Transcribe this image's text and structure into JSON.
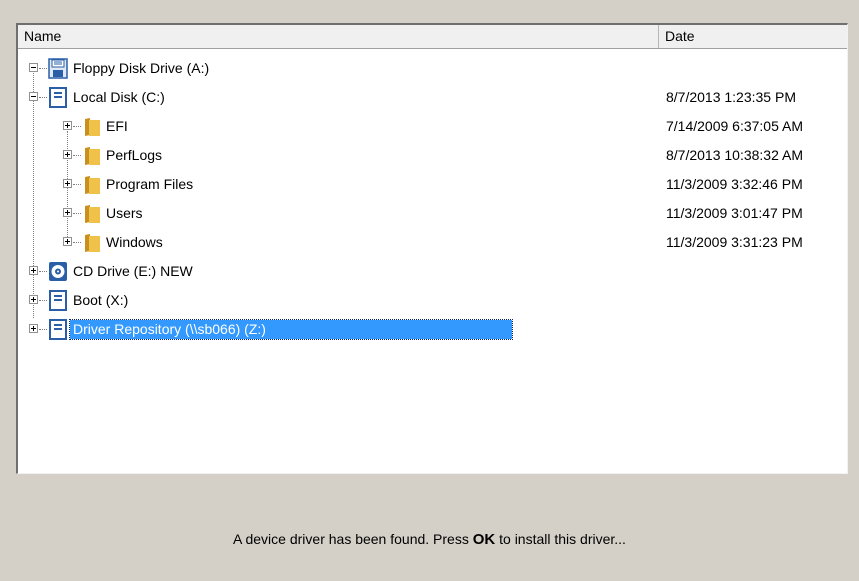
{
  "columns": {
    "name": "Name",
    "date": "Date"
  },
  "tree": {
    "floppy": {
      "label": "Floppy Disk Drive (A:)",
      "date": ""
    },
    "local_c": {
      "label": "Local Disk (C:)",
      "date": "8/7/2013 1:23:35 PM"
    },
    "efi": {
      "label": "EFI",
      "date": "7/14/2009 6:37:05 AM"
    },
    "perflogs": {
      "label": "PerfLogs",
      "date": "8/7/2013 10:38:32 AM"
    },
    "program_files": {
      "label": "Program Files",
      "date": "11/3/2009 3:32:46 PM"
    },
    "users": {
      "label": "Users",
      "date": "11/3/2009 3:01:47 PM"
    },
    "windows": {
      "label": "Windows",
      "date": "11/3/2009 3:31:23 PM"
    },
    "cd_e": {
      "label": "CD Drive (E:) NEW",
      "date": ""
    },
    "boot_x": {
      "label": "Boot (X:)",
      "date": ""
    },
    "driver_repo": {
      "label": "Driver Repository (\\\\sb066) (Z:)",
      "date": "",
      "selected": true
    }
  },
  "status": {
    "prefix": "A device driver has been found. Press ",
    "bold": "OK",
    "suffix": " to install this driver..."
  },
  "colors": {
    "selection": "#3399ff",
    "folder": "#e8b437",
    "drive": "#2a5fa8",
    "background": "#d4d0c8"
  }
}
